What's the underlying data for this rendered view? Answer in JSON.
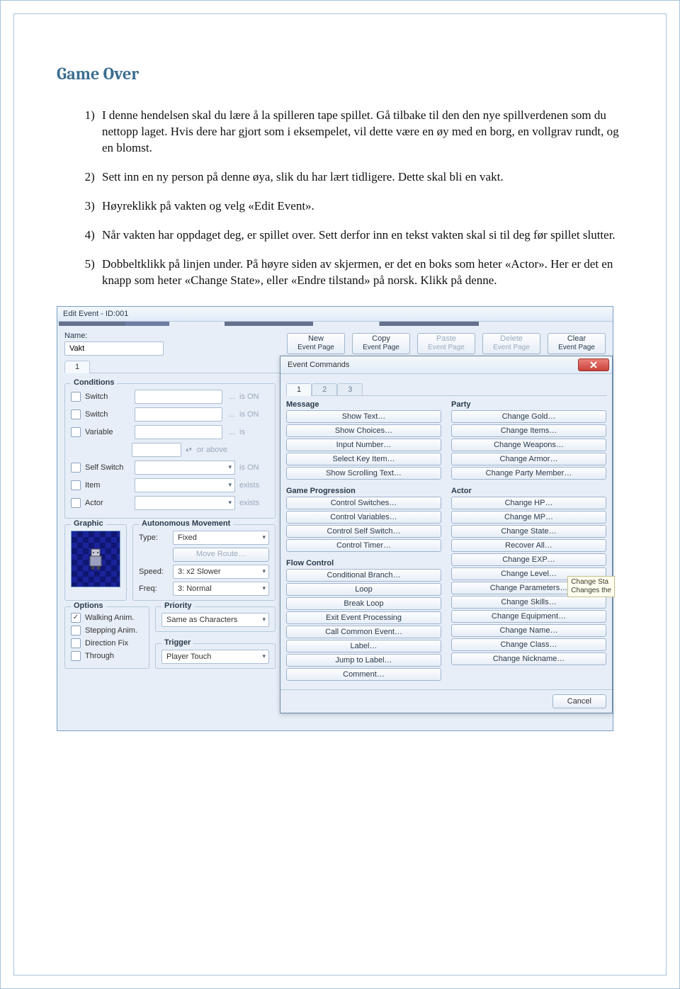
{
  "doc": {
    "heading": "Game Over",
    "steps": [
      "I denne hendelsen skal du lære å la spilleren tape spillet. Gå tilbake til den den nye spillverdenen som du nettopp laget. Hvis dere har gjort som i eksempelet, vil dette være en øy med en borg, en vollgrav rundt, og en blomst.",
      "Sett inn en ny person på denne øya, slik du har lært tidligere. Dette skal bli en vakt.",
      "Høyreklikk på vakten og velg «Edit Event».",
      "Når vakten har oppdaget deg, er spillet over. Sett derfor inn en tekst vakten skal si til deg før spillet slutter.",
      "Dobbeltklikk på linjen under. På høyre siden av skjermen, er det en boks som heter «Actor». Her er det en knapp som heter «Change State», eller «Endre tilstand» på norsk. Klikk på denne."
    ]
  },
  "editEvent": {
    "title": "Edit Event - ID:001",
    "nameLabel": "Name:",
    "nameValue": "Vakt",
    "btnNewTop": "New",
    "btnNewBot": "Event Page",
    "btnCopyTop": "Copy",
    "btnCopyBot": "Event Page",
    "btnPasteTop": "Paste",
    "btnPasteBot": "Event Page",
    "btnDeleteTop": "Delete",
    "btnDeleteBot": "Event Page",
    "btnClearTop": "Clear",
    "btnClearBot": "Event Page",
    "tab1": "1",
    "groups": {
      "conditions": {
        "legend": "Conditions",
        "rows": [
          {
            "label": "Switch",
            "suffix": "is ON"
          },
          {
            "label": "Switch",
            "suffix": "is ON"
          },
          {
            "label": "Variable",
            "suffix": "is"
          },
          {
            "label": "",
            "suffix": "or above"
          },
          {
            "label": "Self Switch",
            "suffix": "is ON"
          },
          {
            "label": "Item",
            "suffix": "exists"
          },
          {
            "label": "Actor",
            "suffix": "exists"
          }
        ]
      },
      "graphic": {
        "legend": "Graphic"
      },
      "movement": {
        "legend": "Autonomous Movement",
        "typeLabel": "Type:",
        "typeValue": "Fixed",
        "moveRoute": "Move Route…",
        "speedLabel": "Speed:",
        "speedValue": "3: x2 Slower",
        "freqLabel": "Freq:",
        "freqValue": "3: Normal"
      },
      "options": {
        "legend": "Options",
        "items": [
          "Walking Anim.",
          "Stepping Anim.",
          "Direction Fix",
          "Through"
        ],
        "checked": [
          true,
          false,
          false,
          false
        ]
      },
      "priority": {
        "legend": "Priority",
        "value": "Same as Characters"
      },
      "trigger": {
        "legend": "Trigger",
        "value": "Player Touch"
      }
    }
  },
  "eventCommands": {
    "title": "Event Commands",
    "tabs": [
      "1",
      "2",
      "3"
    ],
    "left": {
      "message": {
        "label": "Message",
        "items": [
          "Show Text…",
          "Show Choices…",
          "Input Number…",
          "Select Key Item…",
          "Show Scrolling Text…"
        ]
      },
      "progression": {
        "label": "Game Progression",
        "items": [
          "Control Switches…",
          "Control Variables…",
          "Control Self Switch…",
          "Control Timer…"
        ]
      },
      "flow": {
        "label": "Flow Control",
        "items": [
          "Conditional Branch…",
          "Loop",
          "Break Loop",
          "Exit Event Processing",
          "Call Common Event…",
          "Label…",
          "Jump to Label…",
          "Comment…"
        ]
      }
    },
    "right": {
      "party": {
        "label": "Party",
        "items": [
          "Change Gold…",
          "Change Items…",
          "Change Weapons…",
          "Change Armor…",
          "Change Party Member…"
        ]
      },
      "actor": {
        "label": "Actor",
        "items": [
          "Change HP…",
          "Change MP…",
          "Change State…",
          "Recover All…",
          "Change EXP…",
          "Change Level…",
          "Change Parameters…",
          "Change Skills…",
          "Change Equipment…",
          "Change Name…",
          "Change Class…",
          "Change Nickname…"
        ]
      }
    },
    "tooltipLine1": "Change Sta",
    "tooltipLine2": "Changes the",
    "cancel": "Cancel"
  }
}
